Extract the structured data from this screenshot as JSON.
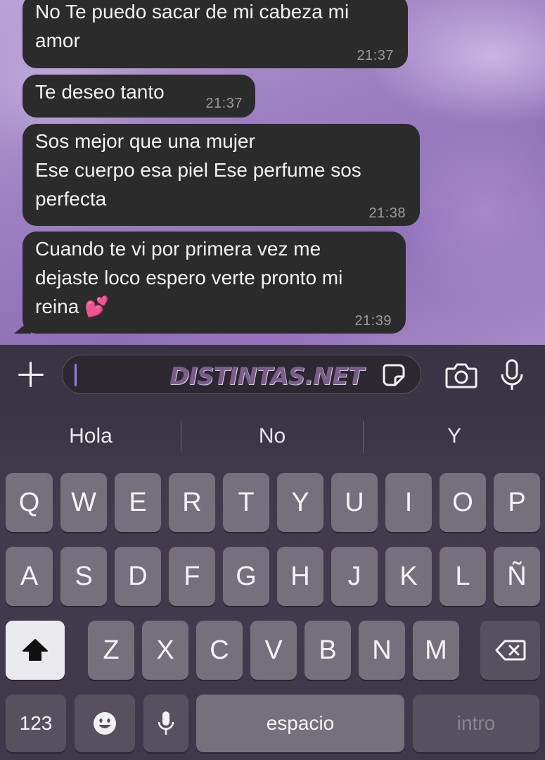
{
  "messages": [
    {
      "text": "No Te puedo sacar de mi cabeza mi\namor",
      "time": "21:37"
    },
    {
      "text": "Te deseo tanto",
      "time": "21:37"
    },
    {
      "text": "Sos mejor que una mujer\nEse cuerpo esa piel Ese perfume sos\nperfecta",
      "time": "21:38"
    },
    {
      "text": "Cuando te vi por primera vez me\ndejaste loco espero verte pronto mi\nreina 💕",
      "time": "21:39"
    }
  ],
  "input": {
    "watermark": "DISTINTAS.NET",
    "value": ""
  },
  "suggestions": [
    "Hola",
    "No",
    "Y"
  ],
  "keyboard": {
    "row1": [
      "Q",
      "W",
      "E",
      "R",
      "T",
      "Y",
      "U",
      "I",
      "O",
      "P"
    ],
    "row2": [
      "A",
      "S",
      "D",
      "F",
      "G",
      "H",
      "J",
      "K",
      "L",
      "Ñ"
    ],
    "row3": [
      "Z",
      "X",
      "C",
      "V",
      "B",
      "N",
      "M"
    ],
    "numbers_label": "123",
    "space_label": "espacio",
    "return_label": "intro"
  },
  "icons": {
    "add": "plus-icon",
    "sticker": "sticker-icon",
    "camera": "camera-icon",
    "mic": "microphone-icon",
    "shift": "shift-icon",
    "backspace": "backspace-icon",
    "emoji": "emoji-icon",
    "dictation": "dictation-mic-icon"
  },
  "colors": {
    "accent_caret": "#8f7cf0",
    "bubble": "#2a2b2a"
  }
}
